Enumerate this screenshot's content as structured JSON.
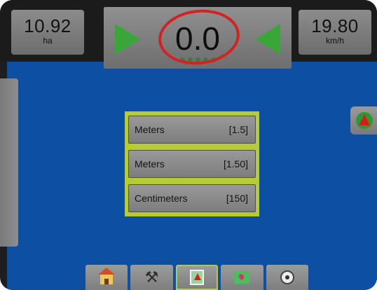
{
  "status": {
    "area_value": "10.92",
    "area_unit": "ha",
    "speed_value": "19.80",
    "speed_unit": "km/h",
    "cross_track_error": "0.0"
  },
  "menu": {
    "items": [
      {
        "label": "Meters",
        "value": "[1.5]"
      },
      {
        "label": "Meters",
        "value": "[1.50]"
      },
      {
        "label": "Centimeters",
        "value": "[150]"
      }
    ]
  },
  "bottom_tabs": [
    {
      "icon": "home-icon",
      "active": false
    },
    {
      "icon": "tools-icon",
      "active": false
    },
    {
      "icon": "guidance-icon",
      "active": true
    },
    {
      "icon": "map-icon",
      "active": false
    },
    {
      "icon": "gauge-icon",
      "active": false
    }
  ],
  "colors": {
    "workspace_blue": "#0d4fa3",
    "accent_green": "#b7cc33",
    "highlight_red": "#d42121",
    "arrow_green": "#3aa63a"
  }
}
